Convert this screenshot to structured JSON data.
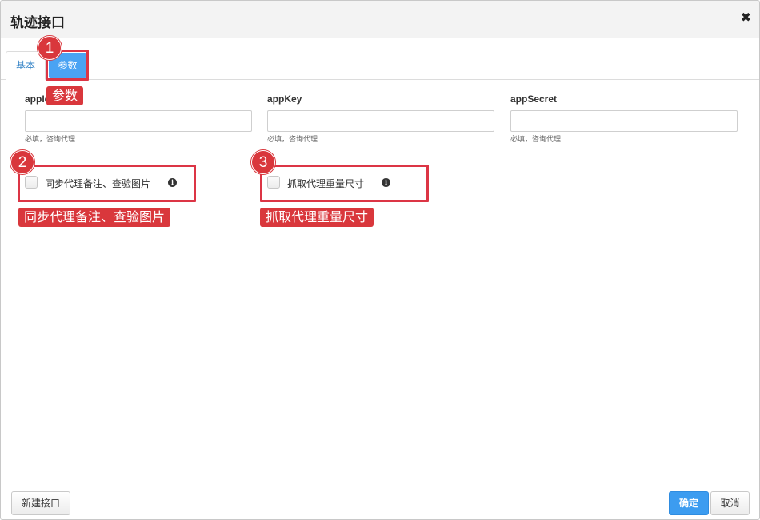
{
  "dialog": {
    "title": "轨迹接口",
    "close_icon": "close-icon",
    "close_glyph": "✖"
  },
  "tabs": [
    {
      "label": "基本",
      "active": false
    },
    {
      "label": "参数",
      "active": true
    }
  ],
  "fields": [
    {
      "label": "appId",
      "value": "",
      "hint": "必填，咨询代理"
    },
    {
      "label": "appKey",
      "value": "",
      "hint": "必填，咨询代理"
    },
    {
      "label": "appSecret",
      "value": "",
      "hint": "必填，咨询代理"
    }
  ],
  "checkboxes": [
    {
      "label": "同步代理备注、查验图片",
      "checked": false,
      "info_icon": "info-icon",
      "info_glyph": "i"
    },
    {
      "label": "抓取代理重量尺寸",
      "checked": false,
      "info_icon": "info-icon",
      "info_glyph": "i"
    }
  ],
  "annotations": [
    {
      "number": "1",
      "label": "参数"
    },
    {
      "number": "2",
      "label": "同步代理备注、查验图片"
    },
    {
      "number": "3",
      "label": "抓取代理重量尺寸"
    }
  ],
  "footer": {
    "new_label": "新建接口",
    "confirm_label": "确定",
    "cancel_label": "取消"
  },
  "colors": {
    "accent": "#3c9cf0",
    "annotation": "#d9373c"
  }
}
